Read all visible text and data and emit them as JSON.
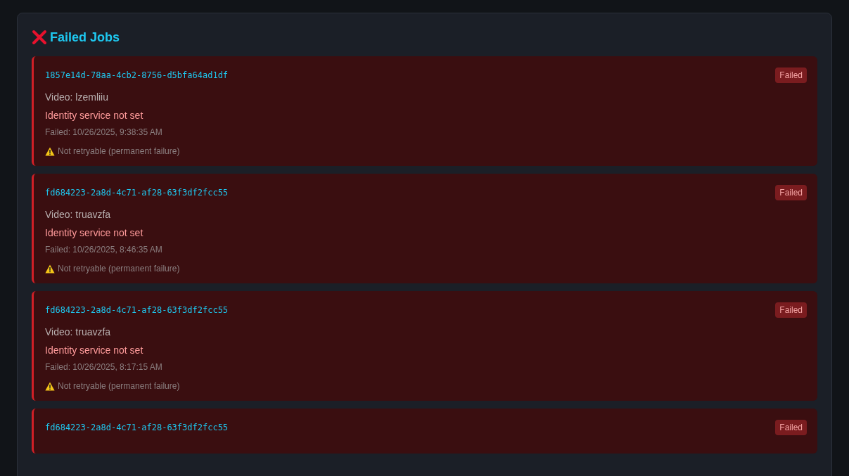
{
  "title": "Failed Jobs",
  "jobs": [
    {
      "id": "1857e14d-78aa-4cb2-8756-d5bfa64ad1df",
      "status": "Failed",
      "video": "Video: lzemliiu",
      "error": "Identity service not set",
      "failed_at": "Failed: 10/26/2025, 9:38:35 AM",
      "note": "Not retryable (permanent failure)"
    },
    {
      "id": "fd684223-2a8d-4c71-af28-63f3df2fcc55",
      "status": "Failed",
      "video": "Video: truavzfa",
      "error": "Identity service not set",
      "failed_at": "Failed: 10/26/2025, 8:46:35 AM",
      "note": "Not retryable (permanent failure)"
    },
    {
      "id": "fd684223-2a8d-4c71-af28-63f3df2fcc55",
      "status": "Failed",
      "video": "Video: truavzfa",
      "error": "Identity service not set",
      "failed_at": "Failed: 10/26/2025, 8:17:15 AM",
      "note": "Not retryable (permanent failure)"
    },
    {
      "id": "fd684223-2a8d-4c71-af28-63f3df2fcc55",
      "status": "Failed"
    }
  ]
}
